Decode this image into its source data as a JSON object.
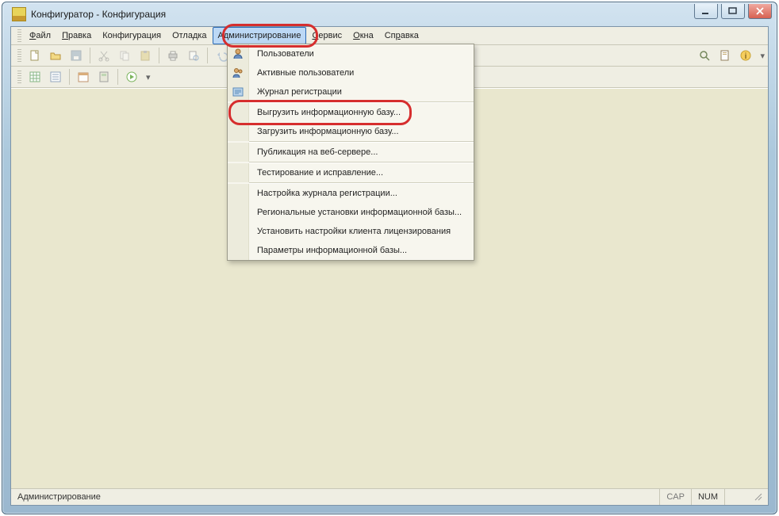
{
  "window": {
    "title": "Конфигуратор - Конфигурация"
  },
  "menubar": {
    "file": {
      "pre": "",
      "u": "Ф",
      "post": "айл"
    },
    "edit": {
      "pre": "",
      "u": "П",
      "post": "равка"
    },
    "config": {
      "label": "Конфигурация"
    },
    "debug": {
      "label": "Отладка"
    },
    "admin": {
      "label": "Администрирование"
    },
    "service": {
      "pre": "",
      "u": "С",
      "post": "ервис"
    },
    "windows": {
      "pre": "",
      "u": "О",
      "post": "кна"
    },
    "help": {
      "pre": "Сп",
      "u": "р",
      "post": "авка"
    }
  },
  "dropdown": {
    "users": "Пользователи",
    "active_users": "Активные пользователи",
    "reg_log": "Журнал регистрации",
    "export_db": "Выгрузить информационную базу...",
    "import_db": "Загрузить информационную базу...",
    "web_publish": "Публикация на веб-сервере...",
    "test_fix": "Тестирование и исправление...",
    "reg_log_setup": "Настройка журнала регистрации...",
    "regional": "Региональные установки информационной базы...",
    "license_client": "Установить настройки клиента лицензирования",
    "db_params": "Параметры информационной базы..."
  },
  "statusbar": {
    "context": "Администрирование",
    "cap": "CAP",
    "num": "NUM"
  }
}
